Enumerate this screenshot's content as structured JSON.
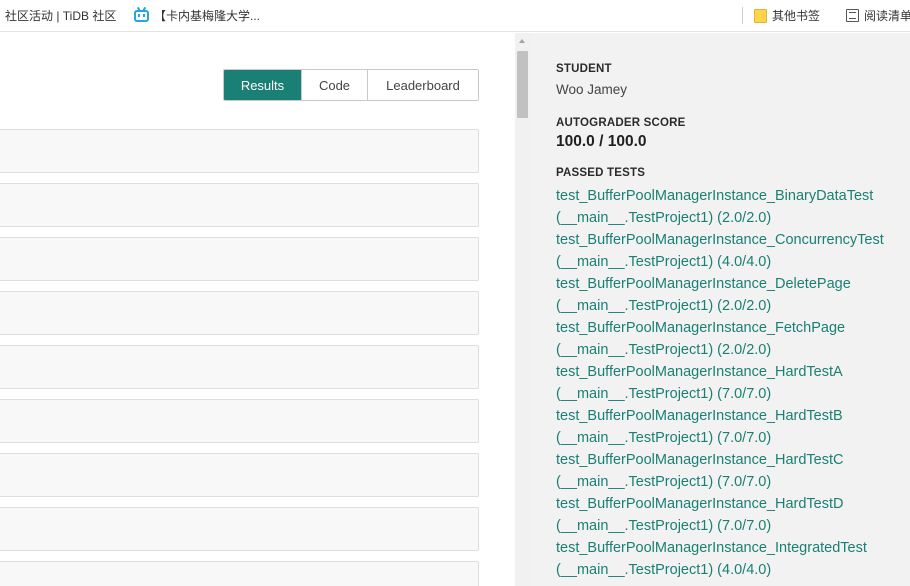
{
  "bookmarks": {
    "items": [
      {
        "label": "社区活动 | TiDB 社区"
      },
      {
        "label": "【卡内基梅隆大学..."
      }
    ],
    "folder_label": "其他书签",
    "reading_list_label": "阅读清单"
  },
  "tabs": {
    "results_label": "Results",
    "code_label": "Code",
    "leaderboard_label": "Leaderboard",
    "active_color": "#1a7f74"
  },
  "rows_count": 9,
  "sidebar": {
    "student_label": "STUDENT",
    "student_name": "Woo Jamey",
    "score_label": "AUTOGRADER SCORE",
    "score_value": "100.0 / 100.0",
    "passed_label": "PASSED TESTS",
    "link_color": "#1a7f74",
    "tests": [
      {
        "name": "test_BufferPoolManagerInstance_BinaryDataTest",
        "detail": "(__main__.TestProject1) (2.0/2.0)"
      },
      {
        "name": "test_BufferPoolManagerInstance_ConcurrencyTest",
        "detail": "(__main__.TestProject1) (4.0/4.0)"
      },
      {
        "name": "test_BufferPoolManagerInstance_DeletePage",
        "detail": "(__main__.TestProject1) (2.0/2.0)"
      },
      {
        "name": "test_BufferPoolManagerInstance_FetchPage",
        "detail": "(__main__.TestProject1) (2.0/2.0)"
      },
      {
        "name": "test_BufferPoolManagerInstance_HardTestA",
        "detail": "(__main__.TestProject1) (7.0/7.0)"
      },
      {
        "name": "test_BufferPoolManagerInstance_HardTestB",
        "detail": "(__main__.TestProject1) (7.0/7.0)"
      },
      {
        "name": "test_BufferPoolManagerInstance_HardTestC",
        "detail": "(__main__.TestProject1) (7.0/7.0)"
      },
      {
        "name": "test_BufferPoolManagerInstance_HardTestD",
        "detail": "(__main__.TestProject1) (7.0/7.0)"
      },
      {
        "name": "test_BufferPoolManagerInstance_IntegratedTest",
        "detail": "(__main__.TestProject1) (4.0/4.0)"
      }
    ]
  }
}
